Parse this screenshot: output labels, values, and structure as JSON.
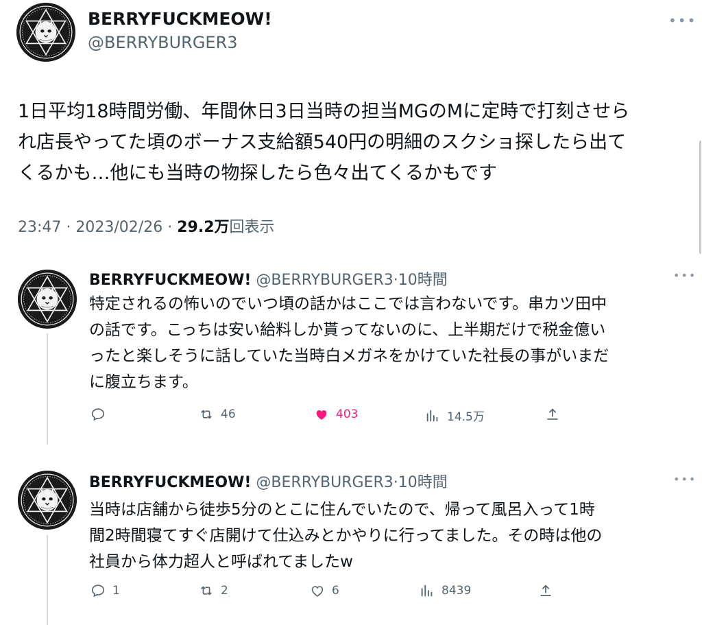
{
  "main_tweet": {
    "display_name": "BERRYFUCKMEOW!",
    "handle": "@BERRYBURGER3",
    "more": "•••",
    "text_line1": "1日平均18時間労働、年間休日3日当時の担当MGのMに定時で打刻させら",
    "text_line2": "れ店長やってた頃のボーナス支給額540円の明細のスクショ探したら出て",
    "text_line3": "くるかも…他にも当時の物探したら色々出てくるかもです",
    "time": "23:47",
    "sep1": "·",
    "date": "2023/02/26",
    "sep2": "·",
    "views": "29.2万",
    "views_label": "回表示"
  },
  "replies": [
    {
      "display_name": "BERRYFUCKMEOW!",
      "handle": "@BERRYBURGER3",
      "sep": "·",
      "time": "10時間",
      "more": "•••",
      "line1": "特定されるの怖いのでいつ頃の話かはここでは言わないです。串カツ田中",
      "line2": "の話です。こっちは安い給料しか貰ってないのに、上半期だけで税金億い",
      "line3": "ったと楽しそうに話していた当時白メガネをかけていた社長の事がいまだ",
      "line4": "に腹立ちます。",
      "reply_count": "",
      "retweet_count": "46",
      "like_count": "403",
      "view_count": "14.5万",
      "liked": true
    },
    {
      "display_name": "BERRYFUCKMEOW!",
      "handle": "@BERRYBURGER3",
      "sep": "·",
      "time": "10時間",
      "more": "•••",
      "line1": "当時は店舗から徒歩5分のとこに住んでいたので、帰って風呂入って1時",
      "line2": "間2時間寝てすぐ店開けて仕込みとかやりに行ってました。その時は他の",
      "line3": "社員から体力超人と呼ばれてましたw",
      "reply_count": "1",
      "retweet_count": "2",
      "like_count": "6",
      "view_count": "8439",
      "liked": false
    }
  ],
  "icons": {
    "reply": "reply-icon",
    "retweet": "retweet-icon",
    "like": "heart-icon",
    "views": "analytics-icon",
    "share": "share-icon",
    "avatar": "cat-star-emblem-avatar"
  },
  "colors": {
    "text": "#0f1419",
    "secondary": "#536471",
    "like_active": "#f91880",
    "thread_line": "#cfd9de"
  }
}
